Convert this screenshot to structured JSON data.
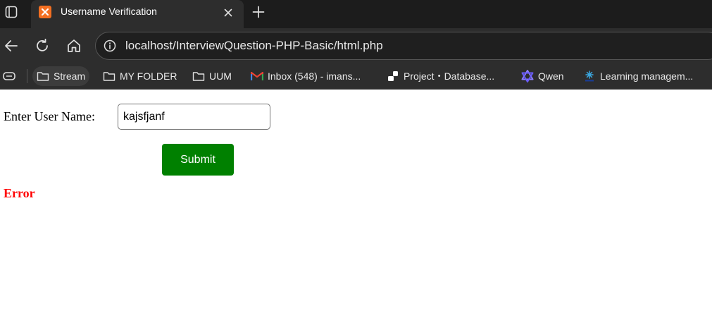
{
  "browser": {
    "tab": {
      "title": "Username Verification",
      "favicon": "xampp-icon"
    },
    "address_bar": {
      "url": "localhost/InterviewQuestion-PHP-Basic/html.php"
    },
    "bookmarks": [
      {
        "label": "Stream",
        "icon": "folder-icon"
      },
      {
        "label": "MY FOLDER",
        "icon": "folder-icon"
      },
      {
        "label": "UUM",
        "icon": "folder-icon"
      },
      {
        "label": "Inbox (548) - imans...",
        "icon": "gmail-icon"
      },
      {
        "label": "Project・Database...",
        "icon": "supabase-icon"
      },
      {
        "label": "Qwen",
        "icon": "qwen-icon"
      },
      {
        "label": "Learning managem...",
        "icon": "lms-icon"
      }
    ]
  },
  "form": {
    "label": "Enter User Name:",
    "input_value": "kajsfjanf",
    "submit_label": "Submit",
    "result": "Error"
  },
  "colors": {
    "submit_bg": "#008000",
    "error_text": "#ff0000",
    "chrome_dark": "#2d2d2d"
  }
}
